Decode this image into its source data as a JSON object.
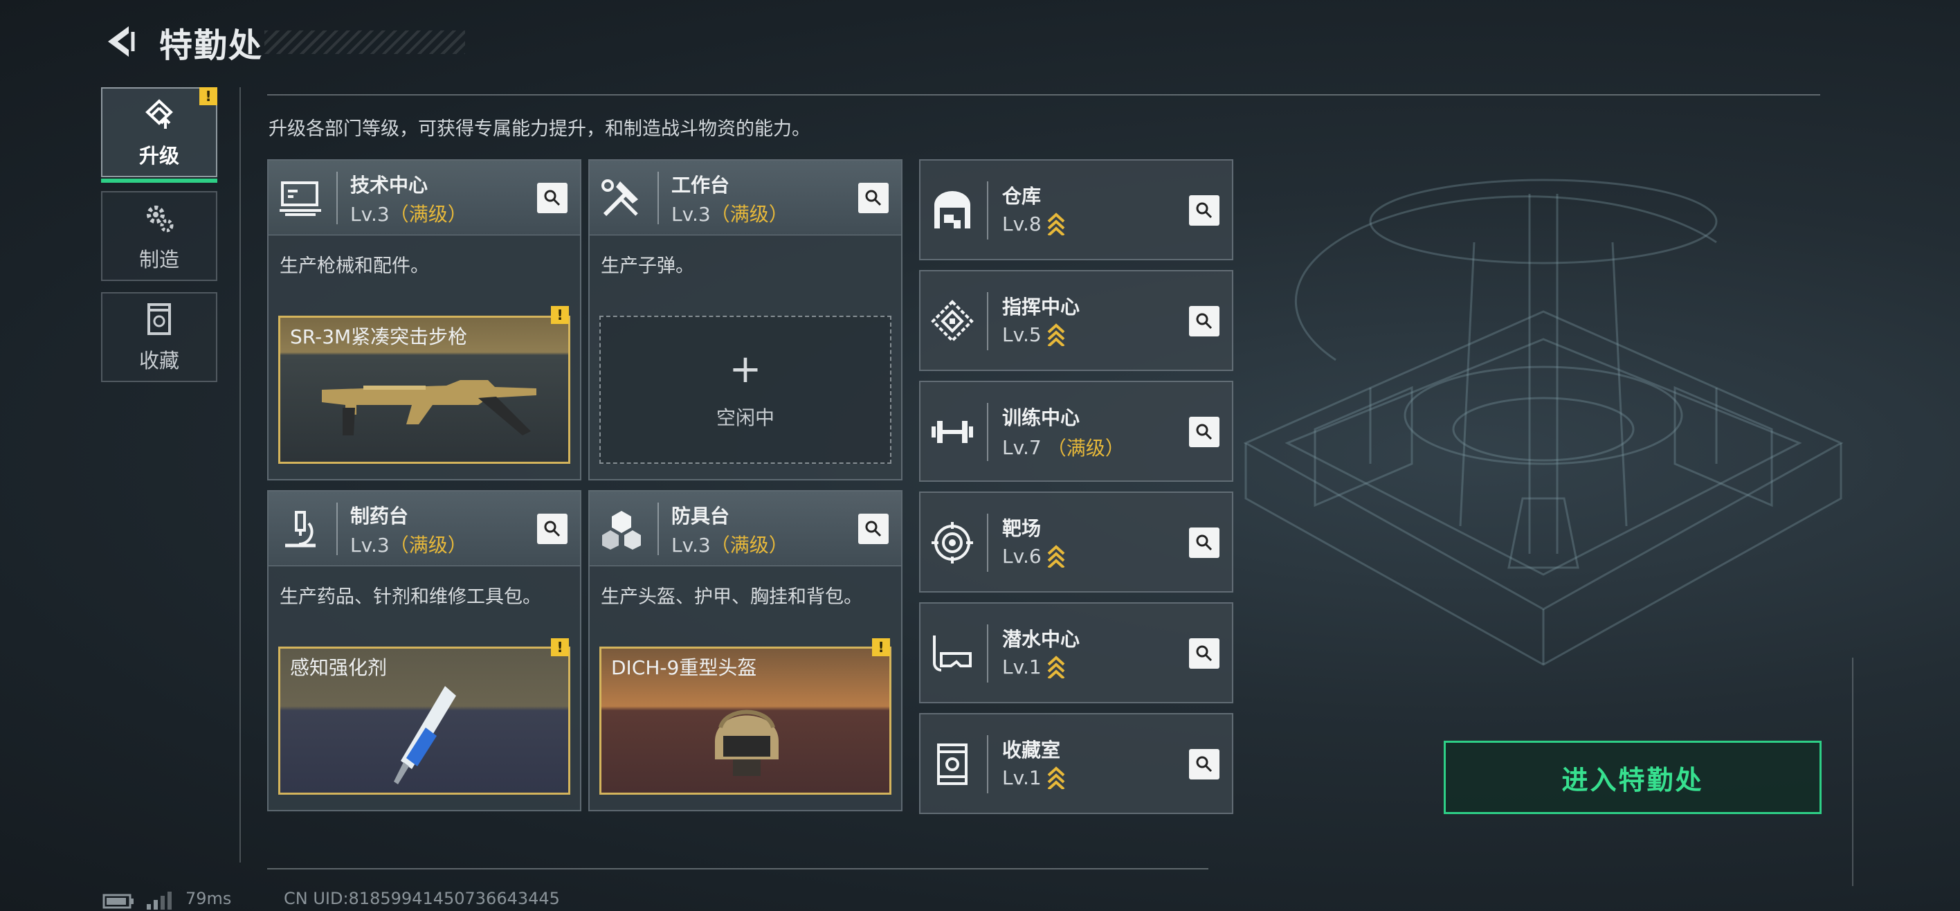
{
  "header": {
    "title": "特勤处"
  },
  "nav": [
    {
      "label": "升级",
      "icon": "upgrade-icon",
      "active": true,
      "warning": "!"
    },
    {
      "label": "制造",
      "icon": "gears-icon",
      "active": false
    },
    {
      "label": "收藏",
      "icon": "collection-icon",
      "active": false
    }
  ],
  "subtitle": "升级各部门等级，可获得专属能力提升，和制造战斗物资的能力。",
  "departments": [
    {
      "name": "技术中心",
      "level": "Lv.3",
      "max": "（满级）",
      "desc": "生产枪械和配件。",
      "icon": "monitor-icon",
      "slot": {
        "label": "SR-3M紧凑突击步枪",
        "icon": "rifle-icon",
        "warning": "!"
      }
    },
    {
      "name": "工作台",
      "level": "Lv.3",
      "max": "（满级）",
      "desc": "生产子弹。",
      "icon": "tools-icon",
      "slot": {
        "plus": "+",
        "label": "空闲中"
      }
    },
    {
      "name": "制药台",
      "level": "Lv.3",
      "max": "（满级）",
      "desc": "生产药品、针剂和维修工具包。",
      "icon": "microscope-icon",
      "slot": {
        "label": "感知强化剂",
        "icon": "syringe-icon",
        "warning": "!"
      }
    },
    {
      "name": "防具台",
      "level": "Lv.3",
      "max": "（满级）",
      "desc": "生产头盔、护甲、胸挂和背包。",
      "icon": "cubes-icon",
      "slot": {
        "label": "DICH-9重型头盔",
        "icon": "helmet-icon",
        "warning": "!"
      }
    }
  ],
  "facilities": [
    {
      "name": "仓库",
      "level": "Lv.8",
      "icon": "warehouse-icon"
    },
    {
      "name": "指挥中心",
      "level": "Lv.5",
      "icon": "command-icon"
    },
    {
      "name": "训练中心",
      "level": "Lv.7",
      "max": "（满级）",
      "icon": "dumbbell-icon"
    },
    {
      "name": "靶场",
      "level": "Lv.6",
      "icon": "target-icon"
    },
    {
      "name": "潜水中心",
      "level": "Lv.1",
      "icon": "diving-mask-icon"
    },
    {
      "name": "收藏室",
      "level": "Lv.1",
      "icon": "trophy-case-icon"
    }
  ],
  "enter_button": "进入特勤处",
  "status": {
    "latency": "79ms",
    "uid": "CN UID:81859941450736643445"
  },
  "colors": {
    "accent_green": "#2ecf86",
    "max_level": "#e8b93a",
    "warning": "#f2c430",
    "slot_border": "#d4b45c"
  }
}
